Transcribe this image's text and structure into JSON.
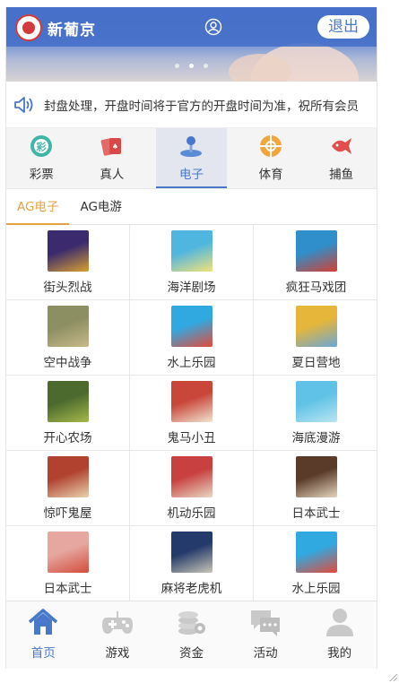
{
  "header": {
    "logo_text": "新葡京",
    "logout_label": "退出"
  },
  "notice": {
    "text": "封盘处理，开盘时间将于官方的开盘时间为准，祝所有会员"
  },
  "categories": [
    {
      "label": "彩票",
      "icon": "lottery-icon",
      "active": false
    },
    {
      "label": "真人",
      "icon": "cards-icon",
      "active": false
    },
    {
      "label": "电子",
      "icon": "joystick-icon",
      "active": true
    },
    {
      "label": "体育",
      "icon": "ball-icon",
      "active": false
    },
    {
      "label": "捕鱼",
      "icon": "fish-icon",
      "active": false
    }
  ],
  "subtabs": [
    {
      "label": "AG电子",
      "active": true
    },
    {
      "label": "AG电游",
      "active": false
    }
  ],
  "games": [
    {
      "name": "街头烈战",
      "colors": [
        "#3b2b6e",
        "#d9a02e"
      ]
    },
    {
      "name": "海洋剧场",
      "colors": [
        "#4fb6df",
        "#f3e27a"
      ]
    },
    {
      "name": "疯狂马戏团",
      "colors": [
        "#2e8fcb",
        "#d4402f"
      ]
    },
    {
      "name": "空中战争",
      "colors": [
        "#8c8f62",
        "#c8b98a"
      ]
    },
    {
      "name": "水上乐园",
      "colors": [
        "#30a9e0",
        "#e34b3a"
      ]
    },
    {
      "name": "夏日营地",
      "colors": [
        "#e5b63a",
        "#6aa7d8"
      ]
    },
    {
      "name": "开心农场",
      "colors": [
        "#4c6a2e",
        "#a5b94a"
      ]
    },
    {
      "name": "鬼马小丑",
      "colors": [
        "#c9463b",
        "#f0e4cf"
      ]
    },
    {
      "name": "海底漫游",
      "colors": [
        "#5fc2e6",
        "#b9e4f1"
      ]
    },
    {
      "name": "惊吓鬼屋",
      "colors": [
        "#b0422f",
        "#e9d3b0"
      ]
    },
    {
      "name": "机动乐园",
      "colors": [
        "#c94040",
        "#e8d9c4"
      ]
    },
    {
      "name": "日本武士",
      "colors": [
        "#5a3b2a",
        "#e5d6c0"
      ]
    },
    {
      "name": "日本武士",
      "colors": [
        "#e6a7a0",
        "#d24c3c"
      ]
    },
    {
      "name": "麻将老虎机",
      "colors": [
        "#243a6a",
        "#c9c6b8"
      ]
    },
    {
      "name": "水上乐园",
      "colors": [
        "#30a9e0",
        "#e34b3a"
      ]
    }
  ],
  "bottom_nav": [
    {
      "label": "首页",
      "icon": "home-icon",
      "active": true
    },
    {
      "label": "游戏",
      "icon": "gamepad-icon",
      "active": false
    },
    {
      "label": "资金",
      "icon": "coins-icon",
      "active": false
    },
    {
      "label": "活动",
      "icon": "chat-icon",
      "active": false
    },
    {
      "label": "我的",
      "icon": "user-icon",
      "active": false
    }
  ],
  "colors": {
    "primary": "#4a78c9",
    "accent_orange": "#e2a245",
    "inactive_icon": "#c9c9c9"
  }
}
